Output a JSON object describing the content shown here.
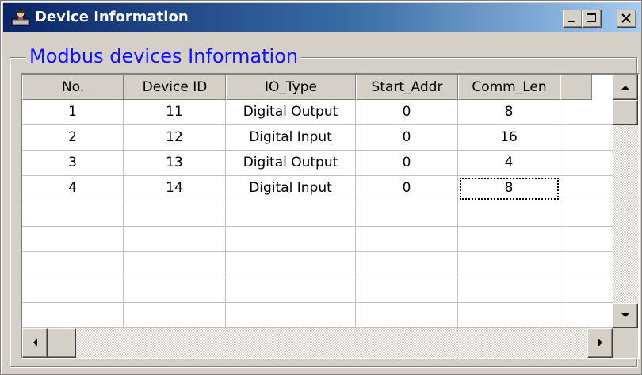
{
  "window": {
    "title": "Device Information",
    "controls": {
      "minimize": "minimize",
      "maximize": "maximize",
      "close": "close"
    }
  },
  "group": {
    "title": "Modbus devices Information"
  },
  "table": {
    "columns": [
      "No.",
      "Device ID",
      "IO_Type",
      "Start_Addr",
      "Comm_Len"
    ],
    "rows": [
      [
        "1",
        "11",
        "Digital Output",
        "0",
        "8"
      ],
      [
        "2",
        "12",
        "Digital Input",
        "0",
        "16"
      ],
      [
        "3",
        "13",
        "Digital Output",
        "0",
        "4"
      ],
      [
        "4",
        "14",
        "Digital Input",
        "0",
        "8"
      ]
    ],
    "empty_rows": 5,
    "focused_cell": {
      "row": 3,
      "col": 4
    }
  },
  "icons": {
    "app": "device-app-icon",
    "scroll_up": "arrow-up-icon",
    "scroll_down": "arrow-down-icon",
    "scroll_left": "arrow-left-icon",
    "scroll_right": "arrow-right-icon"
  },
  "colors": {
    "title_gradient_start": "#0a246a",
    "title_gradient_end": "#a6caf0",
    "group_title": "#1010ff",
    "face": "#d4d0c8"
  }
}
